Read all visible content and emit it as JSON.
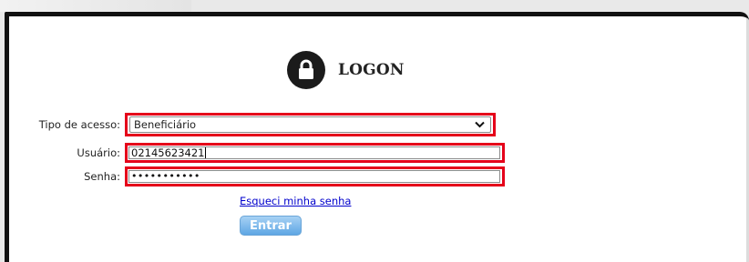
{
  "header": {
    "title": "LOGON",
    "icon": "lock-icon"
  },
  "form": {
    "access_type": {
      "label": "Tipo de acesso:",
      "selected": "Beneficiário"
    },
    "username": {
      "label": "Usuário:",
      "value": "02145623421"
    },
    "password": {
      "label": "Senha:",
      "masked_value": "•••••••••••"
    },
    "forgot_link": "Esqueci minha senha",
    "submit_label": "Entrar"
  },
  "colors": {
    "highlight": "#e5001a",
    "link": "#0000cc",
    "button": "#5ea6e4"
  }
}
